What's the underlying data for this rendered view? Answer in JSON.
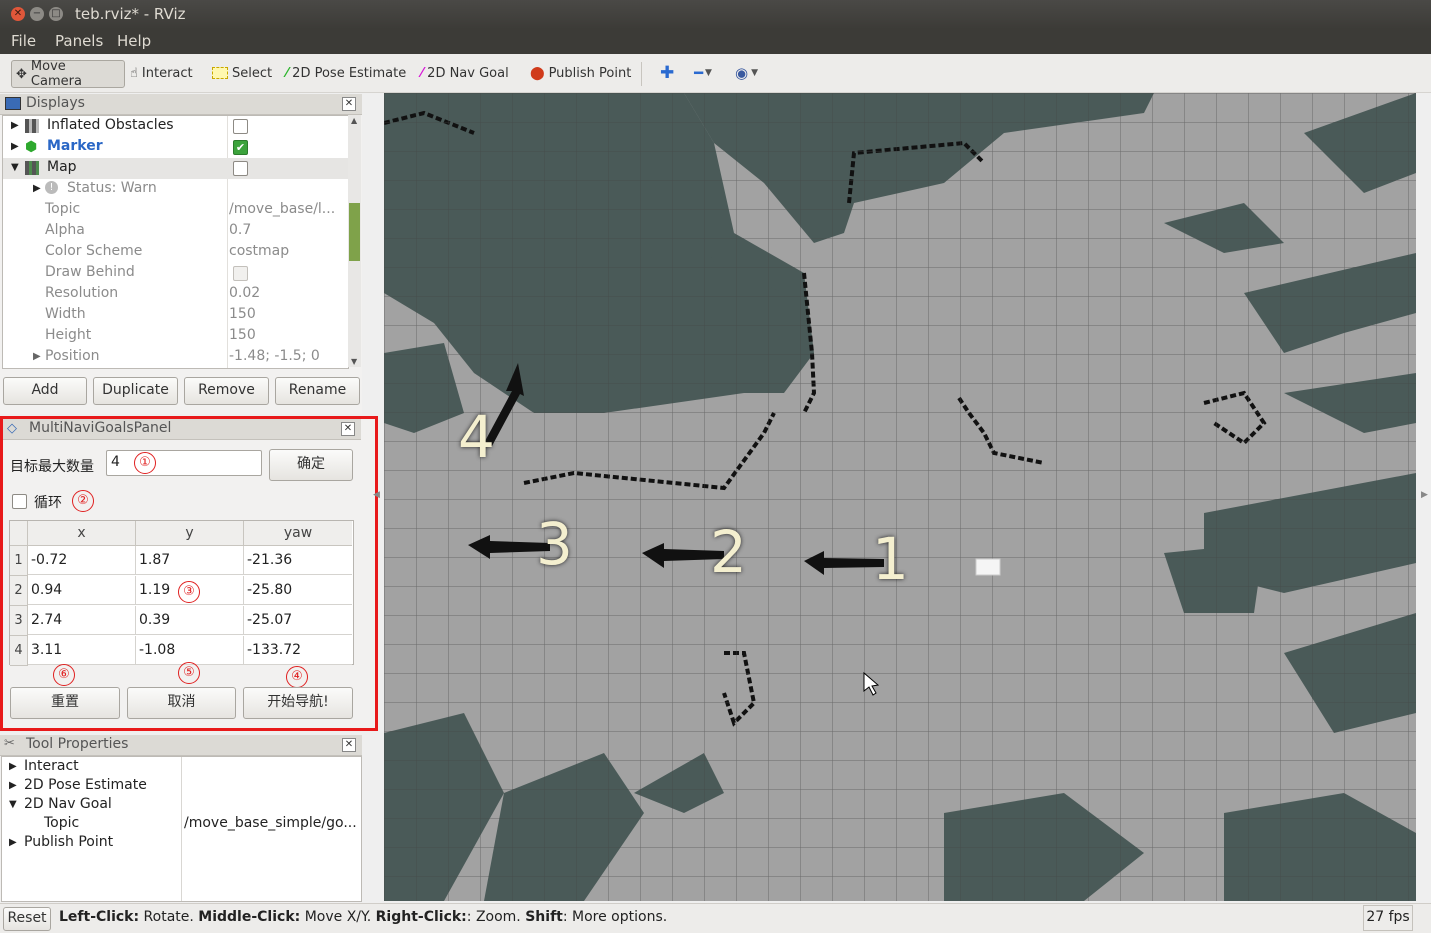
{
  "window": {
    "title": "teb.rviz* - RViz"
  },
  "menu": [
    "File",
    "Panels",
    "Help"
  ],
  "toolbar": {
    "move_camera": "Move Camera",
    "interact": "Interact",
    "select": "Select",
    "pose_estimate": "2D Pose Estimate",
    "nav_goal": "2D Nav Goal",
    "publish_point": "Publish Point"
  },
  "displays": {
    "title": "Displays",
    "items": [
      {
        "name": "Inflated Obstacles",
        "checked": false
      },
      {
        "name": "Marker",
        "checked": true
      },
      {
        "name": "Map",
        "checked": false
      }
    ],
    "map_props": [
      {
        "key": "Status: Warn",
        "value": ""
      },
      {
        "key": "Topic",
        "value": "/move_base/l..."
      },
      {
        "key": "Alpha",
        "value": "0.7"
      },
      {
        "key": "Color Scheme",
        "value": "costmap"
      },
      {
        "key": "Draw Behind",
        "value": ""
      },
      {
        "key": "Resolution",
        "value": "0.02"
      },
      {
        "key": "Width",
        "value": "150"
      },
      {
        "key": "Height",
        "value": "150"
      },
      {
        "key": "Position",
        "value": "-1.48; -1.5; 0"
      }
    ],
    "buttons": {
      "add": "Add",
      "duplicate": "Duplicate",
      "remove": "Remove",
      "rename": "Rename"
    }
  },
  "multi": {
    "title": "MultiNaviGoalsPanel",
    "max_label": "目标最大数量",
    "max_value": "4",
    "confirm": "确定",
    "loop_label": "循环",
    "headers": [
      "x",
      "y",
      "yaw"
    ],
    "rows": [
      [
        "1",
        "-0.72",
        "1.87",
        "-21.36"
      ],
      [
        "2",
        "0.94",
        "1.19",
        "-25.80"
      ],
      [
        "3",
        "2.74",
        "0.39",
        "-25.07"
      ],
      [
        "4",
        "3.11",
        "-1.08",
        "-133.72"
      ]
    ],
    "reset": "重置",
    "cancel": "取消",
    "start": "开始导航!",
    "markers": [
      "①",
      "②",
      "③",
      "④",
      "⑤",
      "⑥"
    ]
  },
  "tool_props": {
    "title": "Tool Properties",
    "items": [
      "Interact",
      "2D Pose Estimate",
      "2D Nav Goal",
      "Topic",
      "Publish Point"
    ],
    "topic_value": "/move_base_simple/go..."
  },
  "status": {
    "reset": "Reset",
    "left": "Left-Click:",
    "left_desc": " Rotate. ",
    "middle": "Middle-Click:",
    "middle_desc": " Move X/Y. ",
    "right": "Right-Click:",
    "right_desc": ": Zoom. ",
    "shift": "Shift",
    "shift_desc": ": More options.",
    "fps": "27 fps"
  },
  "goals_overlay": [
    "1",
    "2",
    "3",
    "4"
  ]
}
